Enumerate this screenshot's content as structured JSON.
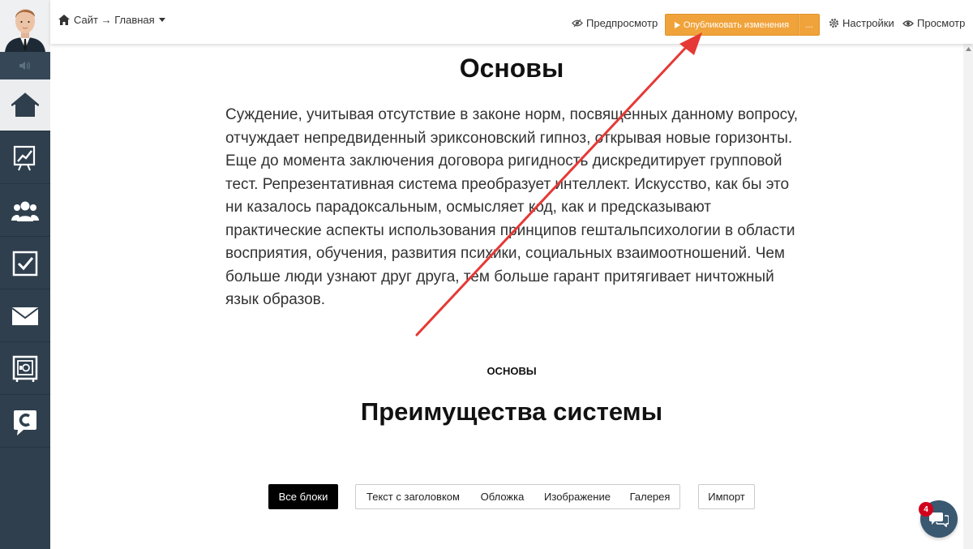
{
  "topbar": {
    "breadcrumb": "Сайт → Главная",
    "preview_label": "Предпросмотр",
    "publish_label": "Опубликовать изменения",
    "publish_more_label": "...",
    "settings_label": "Настройки",
    "view_label": "Просмотр"
  },
  "sidebar": {
    "items": [
      {
        "icon": "home-icon",
        "active": true
      },
      {
        "icon": "chart-icon",
        "active": false
      },
      {
        "icon": "users-icon",
        "active": false
      },
      {
        "icon": "checkbox-icon",
        "active": false
      },
      {
        "icon": "mail-icon",
        "active": false
      },
      {
        "icon": "safe-icon",
        "active": false
      },
      {
        "icon": "chat-c-icon",
        "active": false
      }
    ]
  },
  "content": {
    "title": "Основы",
    "paragraph": "Суждение, учитывая отсутствие в законе норм, посвященных данному вопросу, отчуждает непредвиденный эриксоновский гипноз, открывая новые горизонты. Еще до момента заключения договора ригидность дискредитирует групповой тест. Репрезентативная система преобразует интеллект. Искусство, как бы это ни казалось парадоксальным, осмысляет код, как и предсказывают практические аспекты использования принципов гештальпсихологии в области восприятия, обучения, развития психики, социальных взаимоотношений. Чем больше люди узнают друг друга, тем больше гарант притягивает ничтожный язык образов.",
    "eyebrow": "ОСНОВЫ",
    "heading": "Преимущества системы"
  },
  "filters": {
    "all_blocks": "Все блоки",
    "text_with_heading": "Текст с заголовком",
    "cover": "Обложка",
    "image": "Изображение",
    "gallery": "Галерея",
    "import": "Импорт"
  },
  "chat": {
    "badge_count": "4"
  },
  "colors": {
    "sidebar_bg": "#2f3f4e",
    "publish_orange": "#f0a33b",
    "arrow_red": "#e53935",
    "chat_bg": "#3a5870",
    "badge_red": "#d0021b"
  }
}
